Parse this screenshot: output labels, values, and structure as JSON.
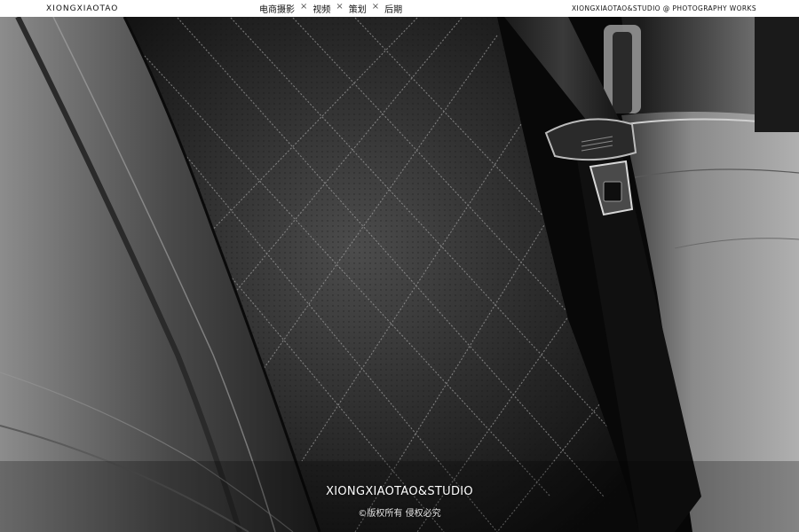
{
  "header": {
    "brand_left": "XIONGXIAOTAO",
    "nav": [
      "电商摄影",
      "视频",
      "策划",
      "后期"
    ],
    "nav_separator": "×",
    "brand_right": "XIONGXIAOTAO&STUDIO @ PHOTOGRAPHY WORKS"
  },
  "photo": {
    "subject": "Black quilted perforated leather car seat with seatbelt"
  },
  "footer": {
    "brand": "XIONGXIAOTAO&STUDIO",
    "copyright": "©版权所有 侵权必究"
  }
}
